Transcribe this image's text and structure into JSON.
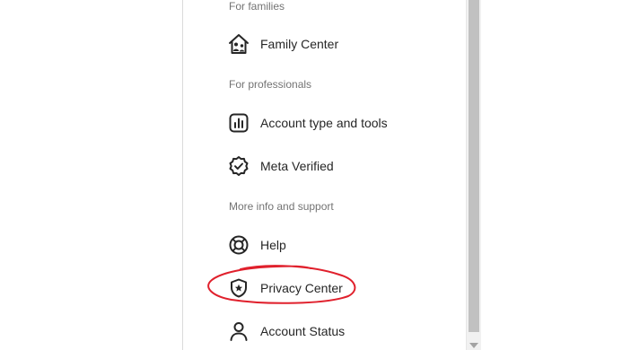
{
  "sections": {
    "families": "For families",
    "professionals": "For professionals",
    "support": "More info and support"
  },
  "items": {
    "family_center": "Family Center",
    "account_type": "Account type and tools",
    "meta_verified": "Meta Verified",
    "help": "Help",
    "privacy_center": "Privacy Center",
    "account_status": "Account Status"
  },
  "colors": {
    "annotation": "#e0202c",
    "text": "#262626",
    "section": "#737373"
  }
}
